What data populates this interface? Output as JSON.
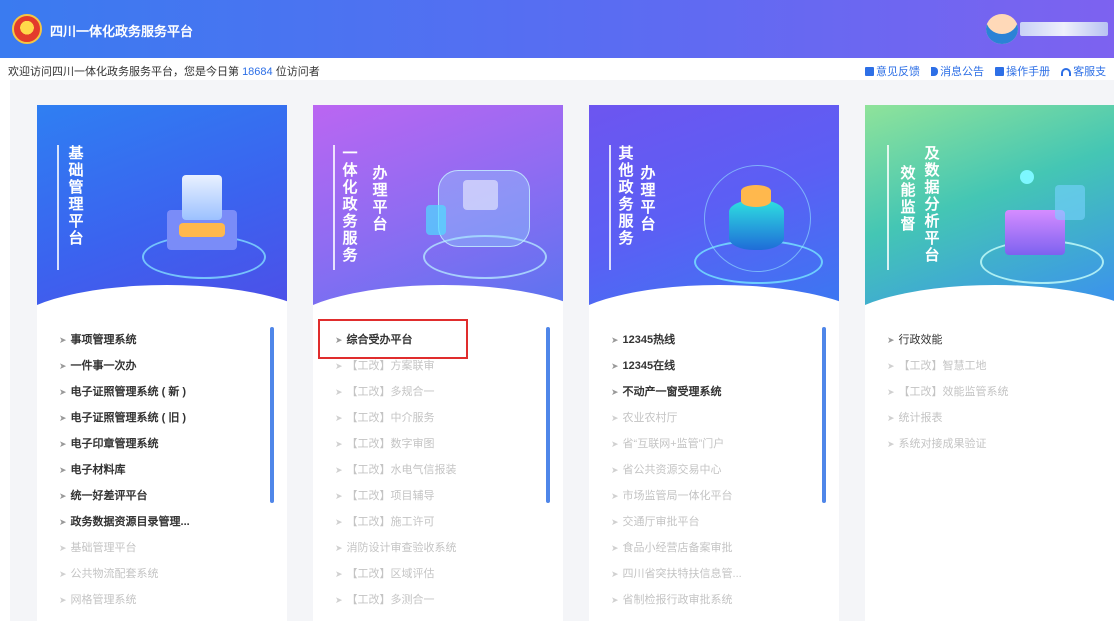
{
  "header": {
    "title": "四川一体化政务服务平台",
    "emblem_icon": "national-emblem-icon",
    "user_icon": "user-avatar-icon"
  },
  "welcome": {
    "prefix": "欢迎访问四川一体化政务服务平台，您是今日第 ",
    "count": "18684",
    "suffix": " 位访问者"
  },
  "top_links": [
    {
      "label": "意见反馈",
      "icon": "feedback-icon"
    },
    {
      "label": "消息公告",
      "icon": "speaker-icon"
    },
    {
      "label": "操作手册",
      "icon": "manual-icon"
    },
    {
      "label": "客服支",
      "icon": "headset-icon"
    }
  ],
  "colors": {
    "card1": "#3a7df0",
    "card2": "#c46cf0",
    "card3": "#5b6cf5",
    "card4": "#4ec3a0",
    "highlight": "#e02d2d",
    "accent": "#2d6fe6"
  },
  "cards": [
    {
      "title_a": "基础管理平台",
      "title_b": "",
      "items": [
        "事项管理系统",
        "一件事一次办",
        "电子证照管理系统 ( 新 )",
        "电子证照管理系统 ( 旧 )",
        "电子印章管理系统",
        "电子材料库",
        "统一好差评平台",
        "政务数据资源目录管理...",
        "基础管理平台",
        "公共物流配套系统",
        "网格管理系统"
      ]
    },
    {
      "title_a": "一体化政务服务",
      "title_b": "办理平台",
      "items": [
        "综合受办平台",
        "【工改】方案联审",
        "【工改】多规合一",
        "【工改】中介服务",
        "【工改】数字审图",
        "【工改】水电气信报装",
        "【工改】项目辅导",
        "【工改】施工许可",
        "消防设计审查验收系统",
        "【工改】区域评估",
        "【工改】多测合一"
      ]
    },
    {
      "title_a": "其他政务服务",
      "title_b": "办理平台",
      "items": [
        "12345热线",
        "12345在线",
        "不动产一窗受理系统",
        "农业农村厅",
        "省“互联网+监管”门户",
        "省公共资源交易中心",
        "市场监管局一体化平台",
        "交通厅审批平台",
        "食品小经营店备案审批",
        "四川省突扶特扶信息管...",
        "省制检报行政审批系统"
      ]
    },
    {
      "title_a": "效能监督",
      "title_b": "及数据分析平台",
      "items": [
        "行政效能",
        "【工改】智慧工地",
        "【工改】效能监管系统",
        "统计报表",
        "系统对接成果验证"
      ]
    }
  ]
}
